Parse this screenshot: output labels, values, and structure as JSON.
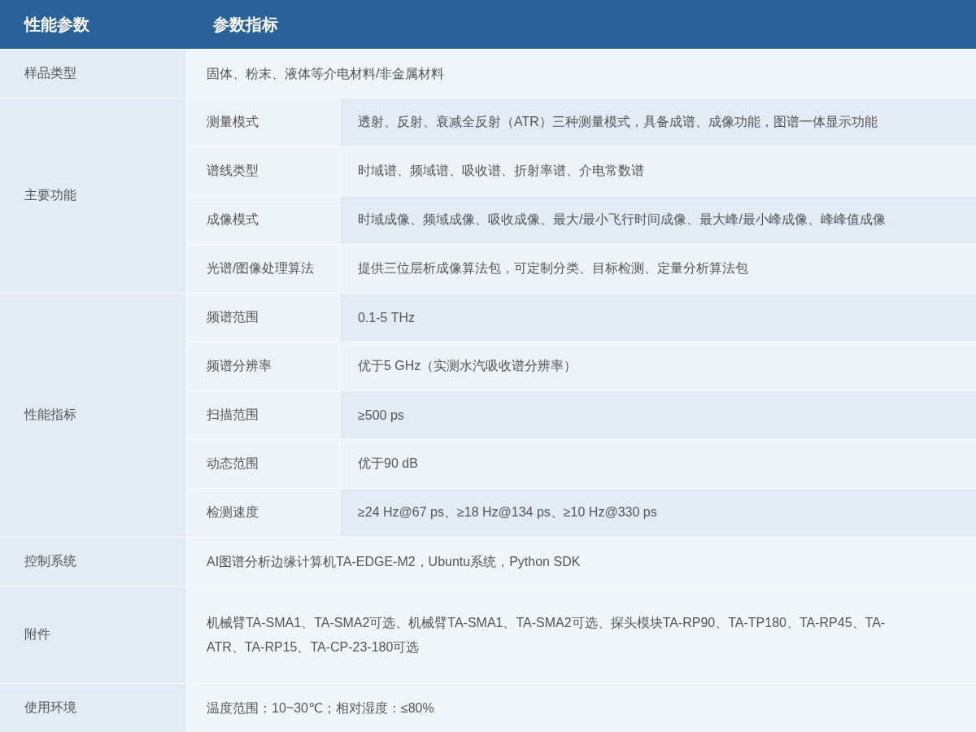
{
  "header": [
    "性能参数",
    "参数指标"
  ],
  "rows": [
    {
      "kind": "simple",
      "label": "样品类型",
      "value": "固体、粉末、液体等介电材料/非金属材料"
    },
    {
      "kind": "group",
      "label": "主要功能",
      "items": [
        {
          "label": "测量模式",
          "value": "透射、反射、衰减全反射（ATR）三种测量模式，具备成谱、成像功能，图谱一体显示功能"
        },
        {
          "label": "谱线类型",
          "value": "时域谱、频域谱、吸收谱、折射率谱、介电常数谱"
        },
        {
          "label": "成像模式",
          "value": "时域成像、频域成像、吸收成像、最大/最小飞行时间成像、最大峰/最小峰成像、峰峰值成像"
        },
        {
          "label": "光谱/图像处理算法",
          "value": "提供三位层析成像算法包，可定制分类、目标检测、定量分析算法包"
        }
      ]
    },
    {
      "kind": "group",
      "label": "性能指标",
      "items": [
        {
          "label": "频谱范围",
          "value": "0.1-5 THz"
        },
        {
          "label": "频谱分辨率",
          "value": "优于5 GHz（实测水汽吸收谱分辨率）"
        },
        {
          "label": "扫描范围",
          "value": "≥500 ps"
        },
        {
          "label": "动态范围",
          "value": "优于90 dB"
        },
        {
          "label": "检测速度",
          "value": "≥24 Hz@67 ps、≥18 Hz@134 ps、≥10 Hz@330 ps"
        }
      ]
    },
    {
      "kind": "simple",
      "label": "控制系统",
      "value": "AI图谱分析边缘计算机TA-EDGE-M2，Ubuntu系统，Python SDK"
    },
    {
      "kind": "simple",
      "tall": true,
      "label": "附件",
      "value": "机械臂TA-SMA1、TA-SMA2可选、机械臂TA-SMA1、TA-SMA2可选、探头模块TA-RP90、TA-TP180、TA-RP45、TA-ATR、TA-RP15、TA-CP-23-180可选"
    },
    {
      "kind": "simple",
      "label": "使用环境",
      "value": "温度范围：10~30℃；相对湿度：≤80%"
    }
  ]
}
